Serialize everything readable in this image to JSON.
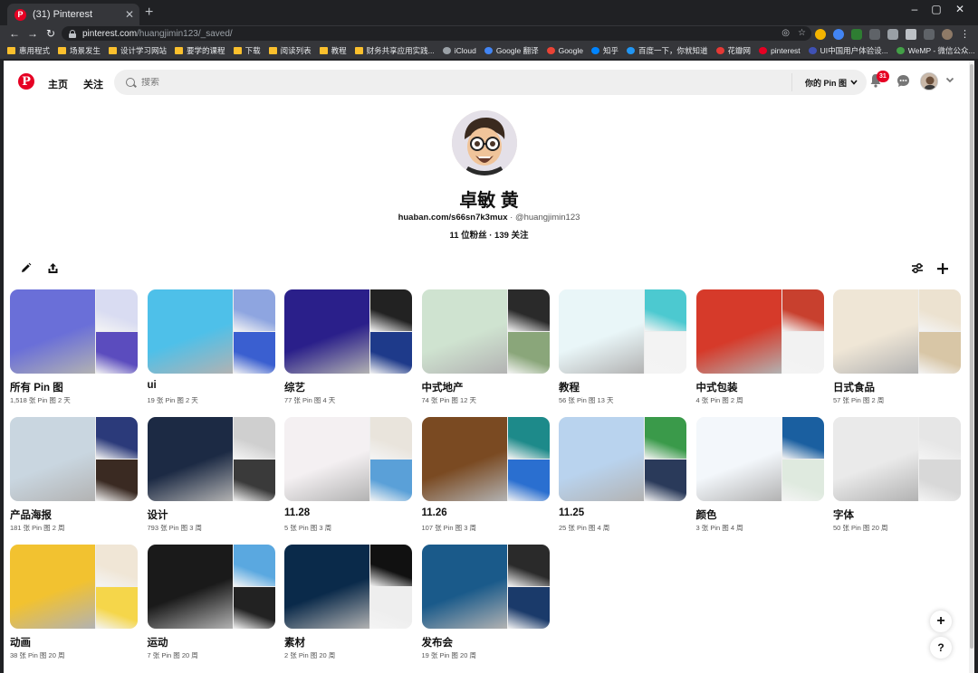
{
  "browser": {
    "tab_title": "(31) Pinterest",
    "tab_favicon": "P",
    "url_host": "pinterest.com",
    "url_path": "/huangjimin123/_saved/",
    "bookmarks": [
      "惠用程式",
      "场景发生",
      "设计学习网站",
      "要学的课程",
      "下载",
      "阅读列表",
      "教程",
      "财务共享应用实践...",
      "iCloud",
      "Google 翻译",
      "Google",
      "知乎",
      "百度一下，你就知道",
      "花瓣网",
      "pinterest",
      "UI中国用户体验设...",
      "WeMP - 微信公众..."
    ]
  },
  "header": {
    "logo": "P",
    "nav_home": "主页",
    "nav_following": "关注",
    "search_placeholder": "搜索",
    "scope_label": "你的 Pin 图",
    "notifications_count": "31"
  },
  "profile": {
    "name": "卓敏 黄",
    "website": "huaban.com/s66sn7k3mux",
    "handle_sep": " · ",
    "handle": "@huangjimin123",
    "stats": "11 位粉丝 · 139 关注"
  },
  "boards": [
    {
      "name": "所有 Pin 图",
      "meta": "1,518 张 Pin 图  2 天",
      "colors": [
        "#6a6fd8",
        "#d9dcf2",
        "#5b4cbe"
      ]
    },
    {
      "name": "ui",
      "meta": "19 张 Pin 图  2 天",
      "colors": [
        "#4ec0e9",
        "#8ea5e0",
        "#3a5fd0"
      ]
    },
    {
      "name": "综艺",
      "meta": "77 张 Pin 图  4 天",
      "colors": [
        "#2a1f8a",
        "#222",
        "#1e3a8a"
      ]
    },
    {
      "name": "中式地产",
      "meta": "74 张 Pin 图  12 天",
      "colors": [
        "#cfe3d0",
        "#2a2a2a",
        "#8aa67a"
      ]
    },
    {
      "name": "教程",
      "meta": "56 张 Pin 图  13 天",
      "colors": [
        "#e9f6f8",
        "#4cc9d0",
        "#f3f3f3"
      ]
    },
    {
      "name": "中式包装",
      "meta": "4 张 Pin 图  2 周",
      "colors": [
        "#d63a2a",
        "#c8402e",
        "#f2f2f2"
      ]
    },
    {
      "name": "日式食品",
      "meta": "57 张 Pin 图  2 周",
      "colors": [
        "#efe6d6",
        "#ece2d0",
        "#d8c6a6"
      ]
    },
    {
      "name": "产品海报",
      "meta": "181 张 Pin 图  2 周",
      "colors": [
        "#c9d6e0",
        "#2b3a7a",
        "#3a2a22"
      ]
    },
    {
      "name": "设计",
      "meta": "793 张 Pin 图  3 周",
      "colors": [
        "#1c2a44",
        "#cfcfcf",
        "#3a3a3a"
      ]
    },
    {
      "name": "11.28",
      "meta": "5 张 Pin 图  3 周",
      "colors": [
        "#f4f0f2",
        "#e9e4dc",
        "#5aa0d8"
      ]
    },
    {
      "name": "11.26",
      "meta": "107 张 Pin 图  3 周",
      "colors": [
        "#7a4a22",
        "#1d8a8a",
        "#2a6fd0"
      ]
    },
    {
      "name": "11.25",
      "meta": "25 张 Pin 图  4 周",
      "colors": [
        "#b9d3ee",
        "#3a9a4a",
        "#2a3a5a"
      ]
    },
    {
      "name": "颜色",
      "meta": "3 张 Pin 图  4 周",
      "colors": [
        "#f3f7fb",
        "#1a5fa0",
        "#dfeadf"
      ]
    },
    {
      "name": "字体",
      "meta": "50 张 Pin 图  20 周",
      "colors": [
        "#eaeaea",
        "#e6e6e6",
        "#d8d8d8"
      ]
    },
    {
      "name": "动画",
      "meta": "38 张 Pin 图  20 周",
      "colors": [
        "#f2c230",
        "#f0e6d6",
        "#f5d64a"
      ]
    },
    {
      "name": "运动",
      "meta": "7 张 Pin 图  20 周",
      "colors": [
        "#1a1a1a",
        "#5aa8e0",
        "#222"
      ]
    },
    {
      "name": "素材",
      "meta": "2 张 Pin 图  20 周",
      "colors": [
        "#0a2a4a",
        "#111",
        "#eeeeee"
      ]
    },
    {
      "name": "发布会",
      "meta": "19 张 Pin 图  20 周",
      "colors": [
        "#1a5a8a",
        "#2a2a2a",
        "#1a3a6a"
      ]
    }
  ],
  "fab": {
    "add": "+",
    "help": "?"
  }
}
